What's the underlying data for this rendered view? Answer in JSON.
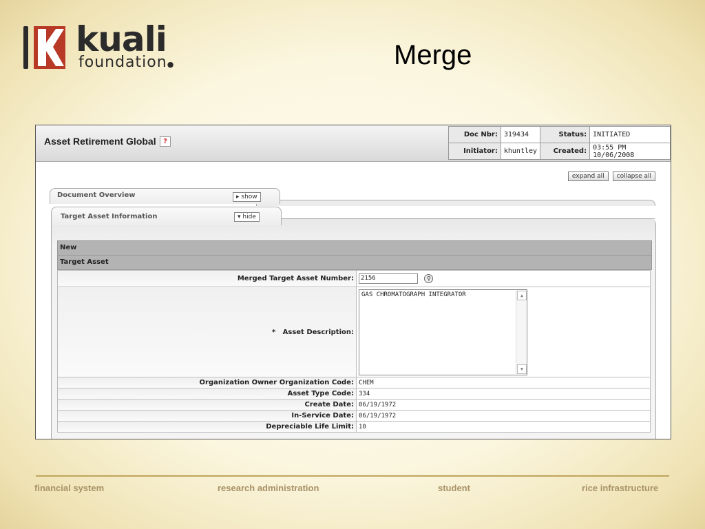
{
  "slide": {
    "title": "Merge"
  },
  "logo": {
    "word": "kuali",
    "sub": "foundation"
  },
  "document": {
    "title": "Asset Retirement Global",
    "help_icon": "question-icon",
    "header": {
      "doc_nbr_label": "Doc Nbr:",
      "doc_nbr": "319434",
      "status_label": "Status:",
      "status": "INITIATED",
      "initiator_label": "Initiator:",
      "initiator": "khuntley",
      "created_label": "Created:",
      "created": "03:55 PM 10/06/2008"
    }
  },
  "controls": {
    "expand_all": "expand all",
    "collapse_all": "collapse all"
  },
  "tabs": [
    {
      "label": "Document Overview",
      "button": "show",
      "button_icon": "triangle-right-icon"
    },
    {
      "label": "Target Asset Information",
      "button": "hide",
      "button_icon": "triangle-down-icon"
    }
  ],
  "sections": {
    "new": "New",
    "target_asset": "Target Asset"
  },
  "form": {
    "merged_target_asset_number": {
      "label": "Merged Target Asset Number:",
      "value": "2156"
    },
    "asset_description": {
      "required": "*",
      "label": "Asset Description:",
      "value": "GAS CHROMATOGRAPH INTEGRATOR"
    },
    "rows": [
      {
        "label": "Organization Owner Organization Code:",
        "value": "CHEM"
      },
      {
        "label": "Asset Type Code:",
        "value": "334"
      },
      {
        "label": "Create Date:",
        "value": "06/19/1972"
      },
      {
        "label": "In-Service Date:",
        "value": "06/19/1972"
      },
      {
        "label": "Depreciable Life Limit:",
        "value": "10"
      }
    ]
  },
  "footer": [
    "financial system",
    "research administration",
    "student",
    "rice infrastructure"
  ]
}
